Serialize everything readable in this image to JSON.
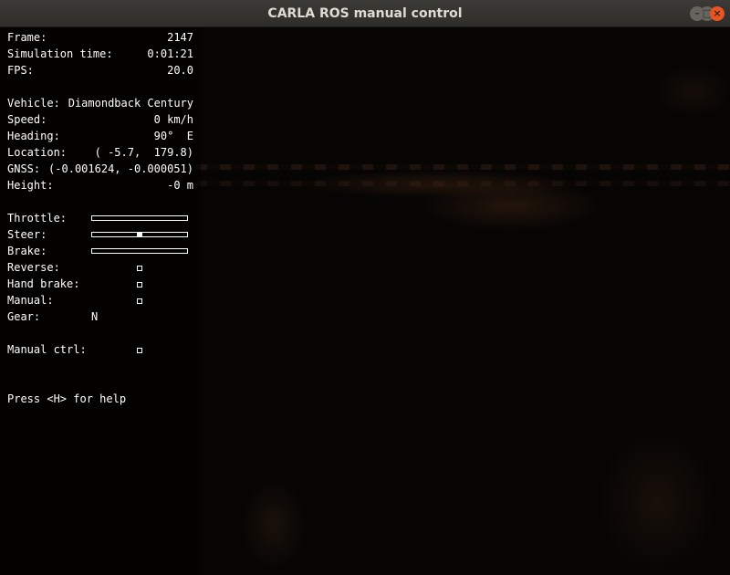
{
  "window": {
    "title": "CARLA ROS manual control"
  },
  "hud": {
    "frame": {
      "label": "Frame:",
      "value": "2147"
    },
    "sim_time": {
      "label": "Simulation time:",
      "value": "0:01:21"
    },
    "fps": {
      "label": "FPS:",
      "value": "20.0"
    },
    "vehicle": {
      "label": "Vehicle:",
      "value": "Diamondback Century"
    },
    "speed": {
      "label": "Speed:",
      "value": "0 km/h"
    },
    "heading": {
      "label": "Heading:",
      "value": "90°  E"
    },
    "location": {
      "label": "Location:",
      "value": "( -5.7,  179.8)"
    },
    "gnss": {
      "label": "GNSS:",
      "value": "(-0.001624, -0.000051)"
    },
    "height": {
      "label": "Height:",
      "value": "-0 m"
    },
    "throttle": {
      "label": "Throttle:",
      "fraction": 0.0
    },
    "steer": {
      "label": "Steer:",
      "value": 0.0
    },
    "brake": {
      "label": "Brake:",
      "fraction": 0.0
    },
    "reverse": {
      "label": "Reverse:",
      "checked": false
    },
    "hand_brake": {
      "label": "Hand brake:",
      "checked": false
    },
    "manual": {
      "label": "Manual:",
      "checked": false
    },
    "gear": {
      "label": "Gear:",
      "value": "N"
    },
    "manual_ctrl": {
      "label": "Manual ctrl:",
      "checked": false
    },
    "help": "Press <H> for help"
  },
  "colors": {
    "close_button": "#e95420",
    "hud_text": "#ffffff"
  }
}
